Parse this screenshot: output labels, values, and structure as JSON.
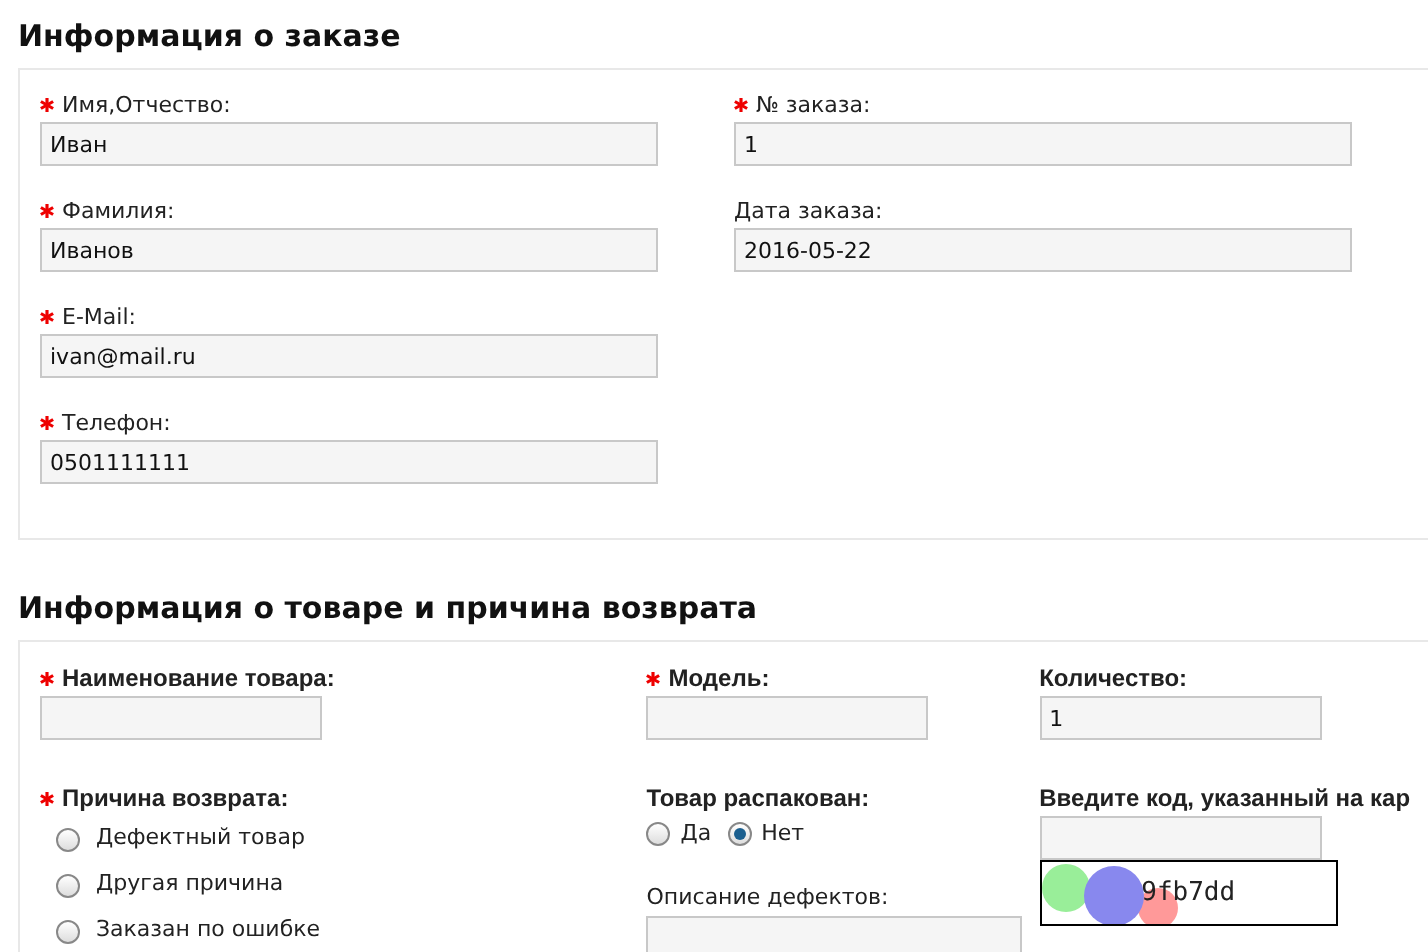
{
  "order_info": {
    "title": "Информация о заказе",
    "columns": [
      [
        {
          "label": "Имя,Отчество:",
          "required": true,
          "value": "Иван"
        },
        {
          "label": "Фамилия:",
          "required": true,
          "value": "Иванов"
        },
        {
          "label": "E-Mail:",
          "required": true,
          "value": "ivan@mail.ru"
        },
        {
          "label": "Телефон:",
          "required": true,
          "value": "0501111111"
        }
      ],
      [
        {
          "label": "№ заказа:",
          "required": true,
          "value": "1"
        },
        {
          "label": "Дата заказа:",
          "value": "2016-05-22"
        }
      ]
    ]
  },
  "product_info": {
    "title": "Информация о товаре и причина возврата",
    "product_name": {
      "label": "Наименование товара:",
      "required": true
    },
    "model": {
      "label": "Модель:",
      "required": true
    },
    "quantity": {
      "label": "Количество:",
      "value": "1"
    },
    "return_reason": {
      "label": "Причина возврата:",
      "required": true,
      "options": [
        {
          "label": "Дефектный товар",
          "selected": false
        },
        {
          "label": "Другая причина",
          "selected": false
        },
        {
          "label": "Заказан по ошибке",
          "selected": false
        }
      ]
    },
    "unpacked": {
      "label": "Товар распакован:",
      "options": [
        {
          "label": "Да",
          "selected": false
        },
        {
          "label": "Нет",
          "selected": true
        }
      ]
    },
    "defects": {
      "label": "Описание дефектов:"
    },
    "captcha": {
      "label": "Введите код, указанный на кар",
      "code": "9fb7dd"
    }
  }
}
